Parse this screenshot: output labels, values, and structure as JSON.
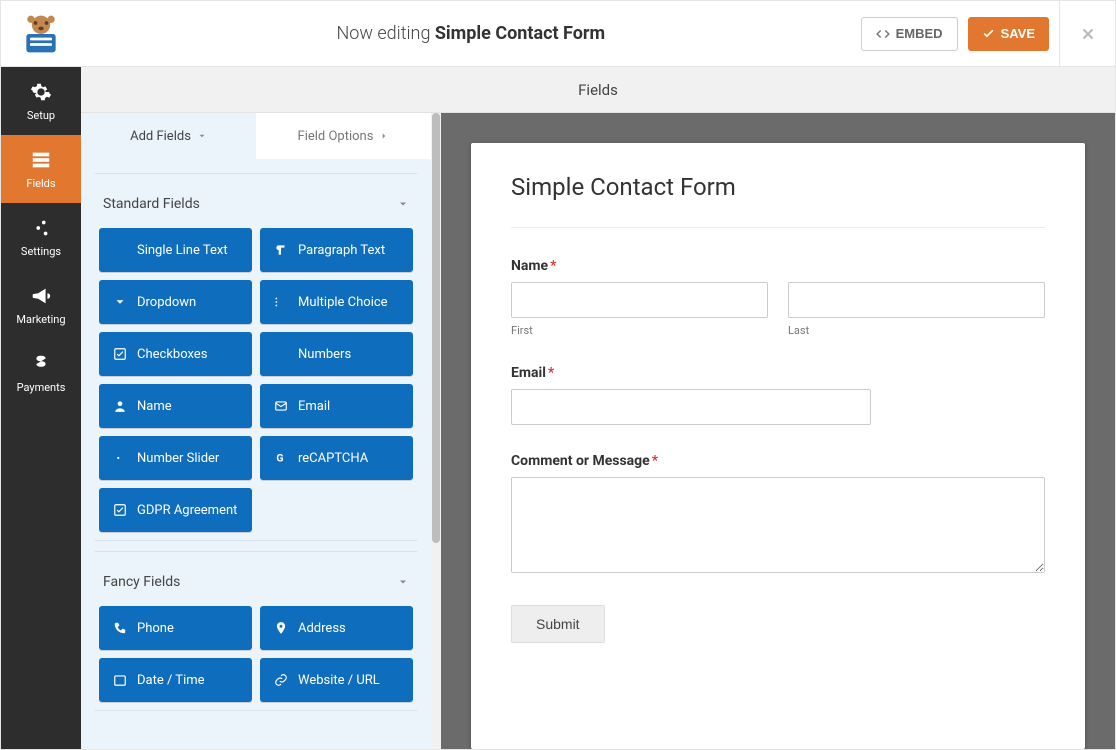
{
  "top": {
    "editing_prefix": "Now editing",
    "form_name": "Simple Contact Form",
    "embed_label": "EMBED",
    "save_label": "SAVE"
  },
  "sidebar": {
    "items": [
      {
        "id": "setup",
        "label": "Setup"
      },
      {
        "id": "fields",
        "label": "Fields"
      },
      {
        "id": "settings",
        "label": "Settings"
      },
      {
        "id": "marketing",
        "label": "Marketing"
      },
      {
        "id": "payments",
        "label": "Payments"
      }
    ]
  },
  "page_title": "Fields",
  "panel": {
    "tabs": {
      "add": "Add Fields",
      "options": "Field Options"
    },
    "standard": {
      "title": "Standard Fields",
      "items": [
        "Single Line Text",
        "Paragraph Text",
        "Dropdown",
        "Multiple Choice",
        "Checkboxes",
        "Numbers",
        "Name",
        "Email",
        "Number Slider",
        "reCAPTCHA",
        "GDPR Agreement"
      ]
    },
    "fancy": {
      "title": "Fancy Fields",
      "items": [
        "Phone",
        "Address",
        "Date / Time",
        "Website / URL"
      ]
    }
  },
  "form": {
    "title": "Simple Contact Form",
    "name_label": "Name",
    "first_sub": "First",
    "last_sub": "Last",
    "email_label": "Email",
    "comment_label": "Comment or Message",
    "submit_label": "Submit",
    "required_mark": "*"
  }
}
